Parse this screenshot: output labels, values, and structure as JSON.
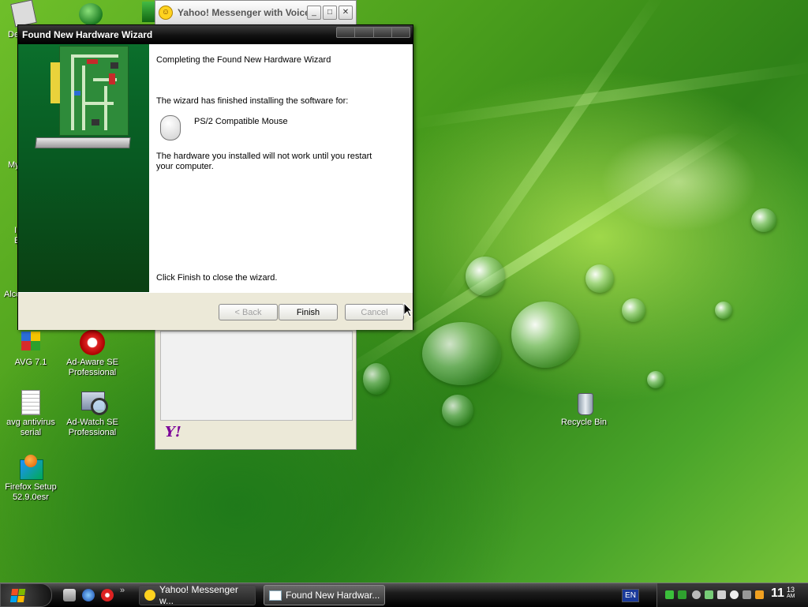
{
  "desktop": {
    "icons": [
      {
        "label": "AVG 7.1",
        "icon": "avg-antivirus-icon"
      },
      {
        "label": "Ad-Aware SE Professional",
        "icon": "ad-aware-icon"
      },
      {
        "label": "avg antivirus serial",
        "icon": "text-document-icon"
      },
      {
        "label": "Ad-Watch SE Professional",
        "icon": "ad-watch-icon"
      },
      {
        "label": "Firefox Setup 52.9.0esr",
        "icon": "installer-icon"
      },
      {
        "label": "Recycle Bin",
        "icon": "recycle-bin-icon"
      }
    ],
    "partial_labels": [
      "De",
      "My",
      "I",
      "E",
      "Alco"
    ]
  },
  "yahoo_window": {
    "title": "Yahoo! Messenger with Voice",
    "logo": "Y!",
    "controls": {
      "minimize": "_",
      "maximize": "□",
      "close": "✕"
    }
  },
  "wizard": {
    "title": "Found New Hardware Wizard",
    "heading": "Completing the Found New Hardware Wizard",
    "finished_text": "The wizard has finished installing the software for:",
    "device_name": "PS/2 Compatible Mouse",
    "restart_line1": "The hardware you installed will not work until you restart",
    "restart_line2": "your computer.",
    "close_hint": "Click Finish to close the wizard.",
    "buttons": {
      "back": "< Back",
      "finish": "Finish",
      "cancel": "Cancel"
    }
  },
  "taskbar": {
    "quick_launch_more": "»",
    "tasks": [
      {
        "label": "Yahoo! Messenger w...",
        "active": false
      },
      {
        "label": "Found New Hardwar...",
        "active": true
      }
    ],
    "language": "EN",
    "clock_hour": "11",
    "clock_minute": "13",
    "clock_ampm": "AM"
  },
  "colors": {
    "accent": "#000000",
    "yahoo_purple": "#7b0099",
    "desktop_green": "#4a9e1c"
  }
}
